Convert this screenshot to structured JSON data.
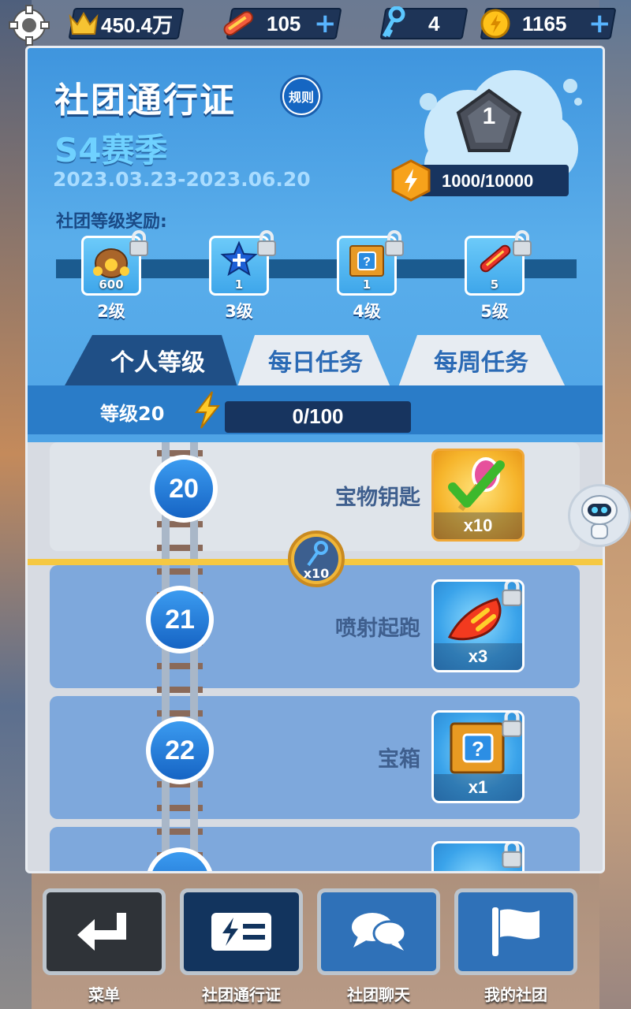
{
  "topbar": {
    "crown_value": "450.4万",
    "boards_value": "105",
    "keys_value": "4",
    "coins_value": "1165"
  },
  "header": {
    "title": "社团通行证",
    "rule_label": "规则",
    "season": "S4赛季",
    "dates": "2023.03.23-2023.06.20",
    "club_level": "1",
    "club_xp": "1000/10000",
    "rewards_label": "社团等级奖励:"
  },
  "club_rewards": [
    {
      "count": "600",
      "level": "2级",
      "icon": "coin-bag-icon"
    },
    {
      "count": "1",
      "level": "3级",
      "icon": "star-icon"
    },
    {
      "count": "1",
      "level": "4级",
      "icon": "mystery-box-icon"
    },
    {
      "count": "5",
      "level": "5级",
      "icon": "hoverboard-icon"
    }
  ],
  "tabs": [
    "个人等级",
    "每日任务",
    "每周任务"
  ],
  "personal": {
    "level_label": "等级20",
    "progress": "0/100"
  },
  "marker": {
    "qty": "x10",
    "icon": "keys-icon"
  },
  "rows": [
    {
      "level": "20",
      "label": "宝物钥匙",
      "qty": "x10",
      "icon": "key-icon",
      "claimed": true
    },
    {
      "level": "21",
      "label": "喷射起跑",
      "qty": "x3",
      "icon": "jet-start-icon",
      "claimed": false
    },
    {
      "level": "22",
      "label": "宝箱",
      "qty": "x1",
      "icon": "mystery-box-icon",
      "claimed": false
    }
  ],
  "nav": [
    "菜单",
    "社团通行证",
    "社团聊天",
    "我的社团"
  ],
  "colors": {
    "accent": "#2a7cc8",
    "tab_active": "#1f4f86",
    "gold": "#f5c842"
  }
}
